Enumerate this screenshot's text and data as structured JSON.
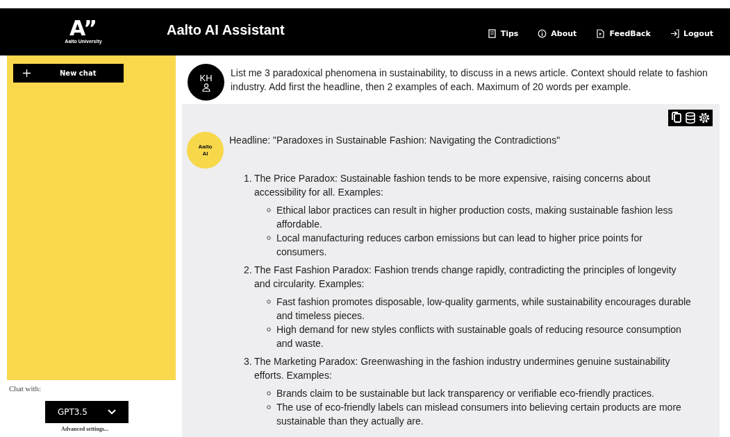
{
  "header": {
    "logo": "A”",
    "logo_caption": "Aalto University",
    "title": "Aalto AI Assistant",
    "nav": [
      {
        "kind": "tips",
        "label": "Tips"
      },
      {
        "kind": "about",
        "label": "About"
      },
      {
        "kind": "feedback",
        "label": "FeedBack"
      },
      {
        "kind": "logout",
        "label": "Logout"
      }
    ]
  },
  "sidebar": {
    "new_chat": "New chat",
    "chat_with_label": "Chat with:",
    "model": "GPT3.5",
    "advanced": "Advanced settings..."
  },
  "question": {
    "avatar": "KH",
    "text": "List me 3 paradoxical phenomena in sustainability, to discuss in a news article. Context should relate to fashion industry. Add first the headline, then 2 examples of each. Maximum of 20 words per example."
  },
  "answer": {
    "avatar": "Aalto AI",
    "tools": [
      {
        "kind": "copy"
      },
      {
        "kind": "database"
      },
      {
        "kind": "settings"
      }
    ],
    "headline": "Headline: \"Paradoxes in Sustainable Fashion: Navigating the Contradictions\"",
    "items": [
      {
        "number": "1.",
        "text": "The Price Paradox: Sustainable fashion tends to be more expensive, raising concerns about accessibility for all. Examples:",
        "examples": [
          "Ethical labor practices can result in higher production costs, making sustainable fashion less affordable.",
          "Local manufacturing reduces carbon emissions but can lead to higher price points for consumers."
        ]
      },
      {
        "number": "2.",
        "text": "The Fast Fashion Paradox: Fashion trends change rapidly, contradicting the principles of longevity and circularity. Examples:",
        "examples": [
          "Fast fashion promotes disposable, low-quality garments, while sustainability encourages durable and timeless pieces.",
          "High demand for new styles conflicts with sustainable goals of reducing resource consumption and waste."
        ]
      },
      {
        "number": "3.",
        "text": "The Marketing Paradox: Greenwashing in the fashion industry undermines genuine sustainability efforts. Examples:",
        "examples": [
          "Brands claim to be sustainable but lack transparency or verifiable eco-friendly practices.",
          "The use of eco-friendly labels can mislead consumers into believing certain products are more sustainable than they actually are."
        ]
      }
    ]
  }
}
